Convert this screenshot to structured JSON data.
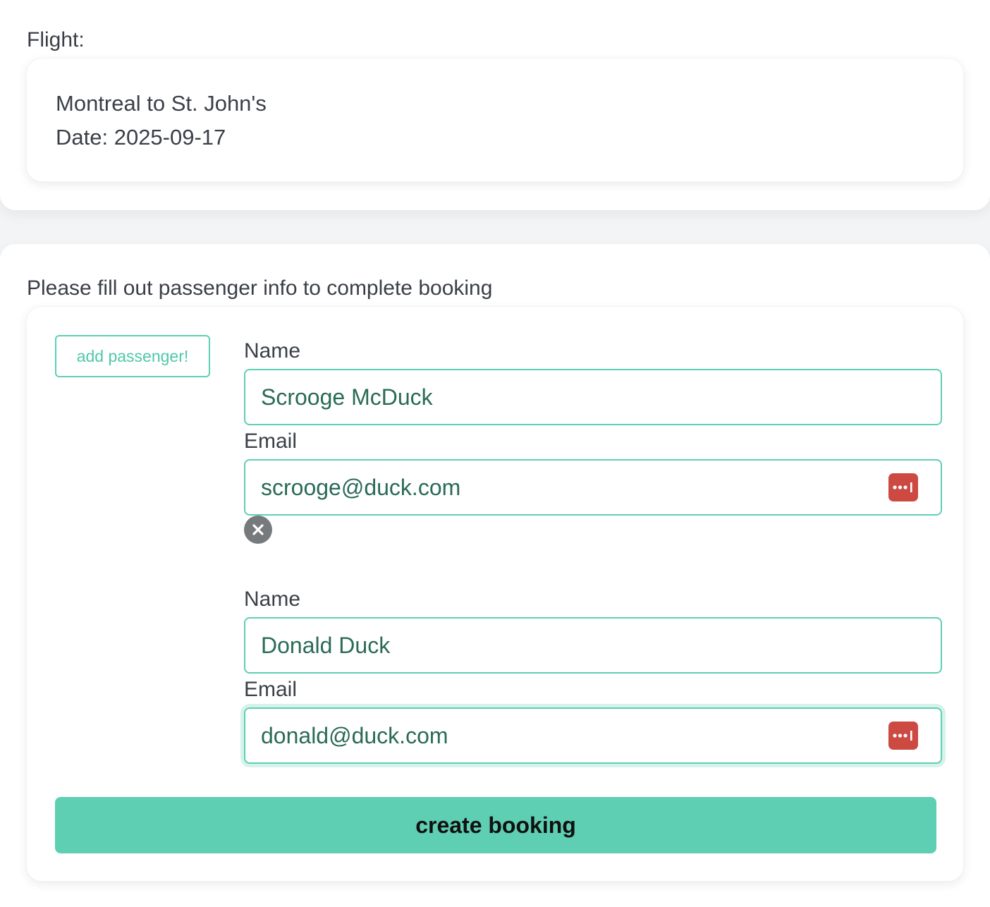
{
  "flight": {
    "section_label": "Flight:",
    "route": "Montreal to St. John's",
    "date": "Date: 2025-09-17"
  },
  "booking": {
    "section_label": "Please fill out passenger info to complete booking",
    "add_passenger_label": "add passenger!",
    "passengers": [
      {
        "name_label": "Name",
        "name_value": "Scrooge McDuck",
        "email_label": "Email",
        "email_value": "scrooge@duck.com"
      },
      {
        "name_label": "Name",
        "name_value": "Donald Duck",
        "email_label": "Email",
        "email_value": "donald@duck.com"
      }
    ],
    "create_button_label": "create booking"
  },
  "colors": {
    "accent": "#5ecfb3",
    "input_text": "#2a6b58",
    "password_manager_icon": "#cd4a43",
    "remove_icon": "#777a7d"
  },
  "icons": {
    "password_manager": "password-manager-icon",
    "remove": "close-icon"
  }
}
